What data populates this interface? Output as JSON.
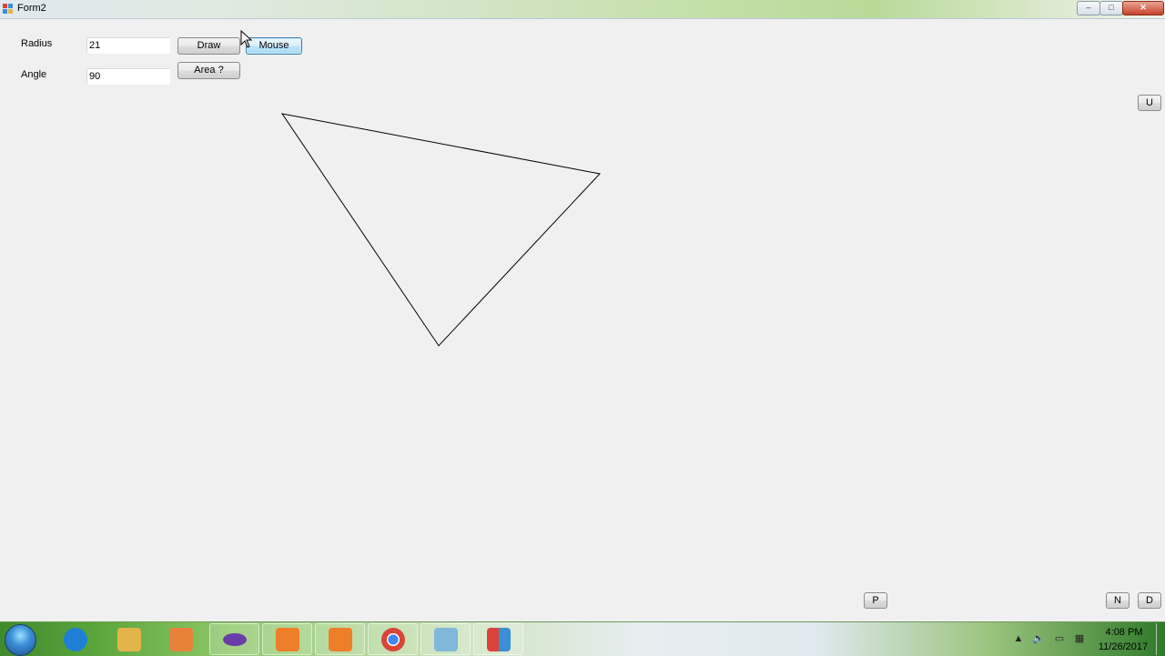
{
  "window": {
    "title": "Form2",
    "controls": {
      "minimize": "–",
      "maximize": "□",
      "close": "✕"
    }
  },
  "form": {
    "radius_label": "Radius",
    "radius_value": "21",
    "angle_label": "Angle",
    "angle_value": "90",
    "draw_label": "Draw",
    "mouse_label": "Mouse",
    "area_label": "Area ?",
    "u_label": "U",
    "p_label": "P",
    "n_label": "N",
    "d_label": "D"
  },
  "taskbar": {
    "items": [
      {
        "icon": "internet-explorer-icon",
        "color": "#1e7fd6"
      },
      {
        "icon": "file-explorer-icon",
        "color": "#e3b448"
      },
      {
        "icon": "media-player-icon",
        "color": "#e8823a"
      },
      {
        "icon": "visual-studio-icon",
        "color": "#6a3ca8"
      },
      {
        "icon": "screen-recorder-icon",
        "color": "#f07d2a"
      },
      {
        "icon": "camera-icon",
        "color": "#f07d2a"
      },
      {
        "icon": "chrome-icon",
        "color": "#db4437"
      },
      {
        "icon": "notepad-icon",
        "color": "#7fb8d8"
      },
      {
        "icon": "windows-forms-app-icon",
        "color": "#d9443a"
      }
    ],
    "clock_time": "4:08 PM",
    "clock_date": "11/26/2017"
  },
  "colors": {
    "window_bg": "#f0f0f0",
    "focus_border": "#3c7fb1",
    "triangle_stroke": "#000000"
  }
}
